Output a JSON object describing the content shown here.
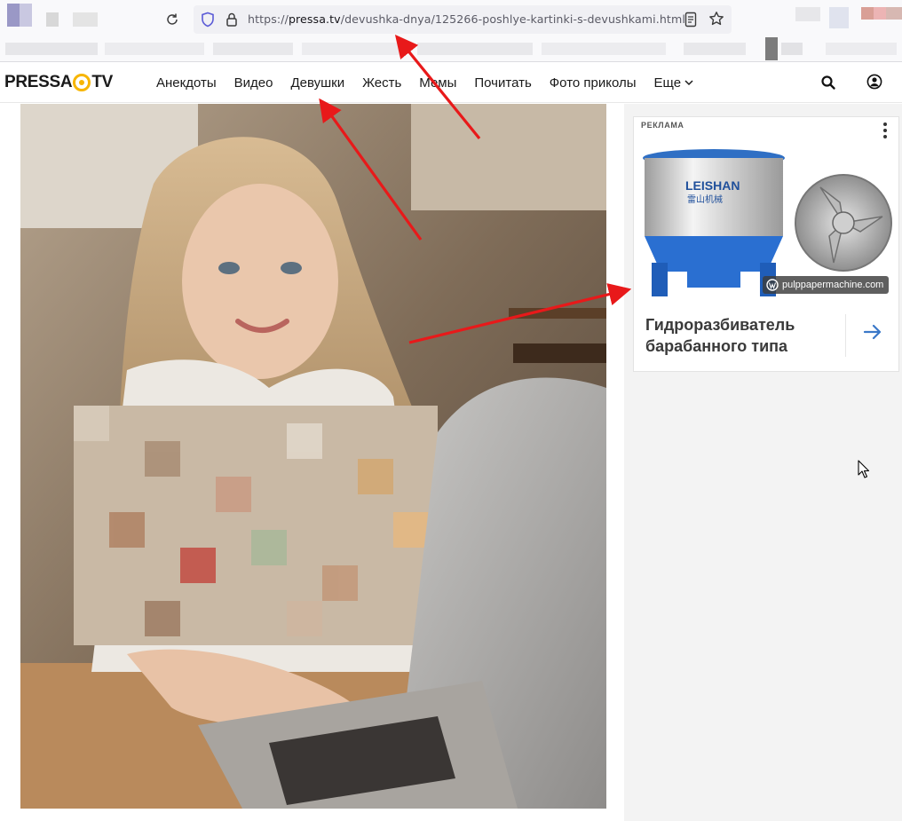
{
  "browser": {
    "url_prefix": "https://",
    "url_domain": "pressa.tv",
    "url_path": "/devushka-dnya/125266-poshlye-kartinki-s-devushkami.html",
    "icons": [
      "reload-icon",
      "shield-icon",
      "lock-icon",
      "reader-view-icon",
      "bookmark-star-icon"
    ]
  },
  "site": {
    "logo_left": "PRESSA",
    "logo_right": "TV",
    "logo_accent": "#f7b500",
    "nav": [
      "Анекдоты",
      "Видео",
      "Девушки",
      "Жесть",
      "Мемы",
      "Почитать",
      "Фото приколы"
    ],
    "nav_more": "Еще",
    "icons": [
      "search-icon",
      "user-icon"
    ]
  },
  "ad": {
    "label": "РЕКЛАМА",
    "brand_text": "LEISHAN",
    "brand_sub": "雷山机械",
    "source": "pulppapermachine.com",
    "title": "Гидроразбиватель барабанного типа",
    "accent": "#3a78c8"
  },
  "annotation_color": "#e8191a"
}
